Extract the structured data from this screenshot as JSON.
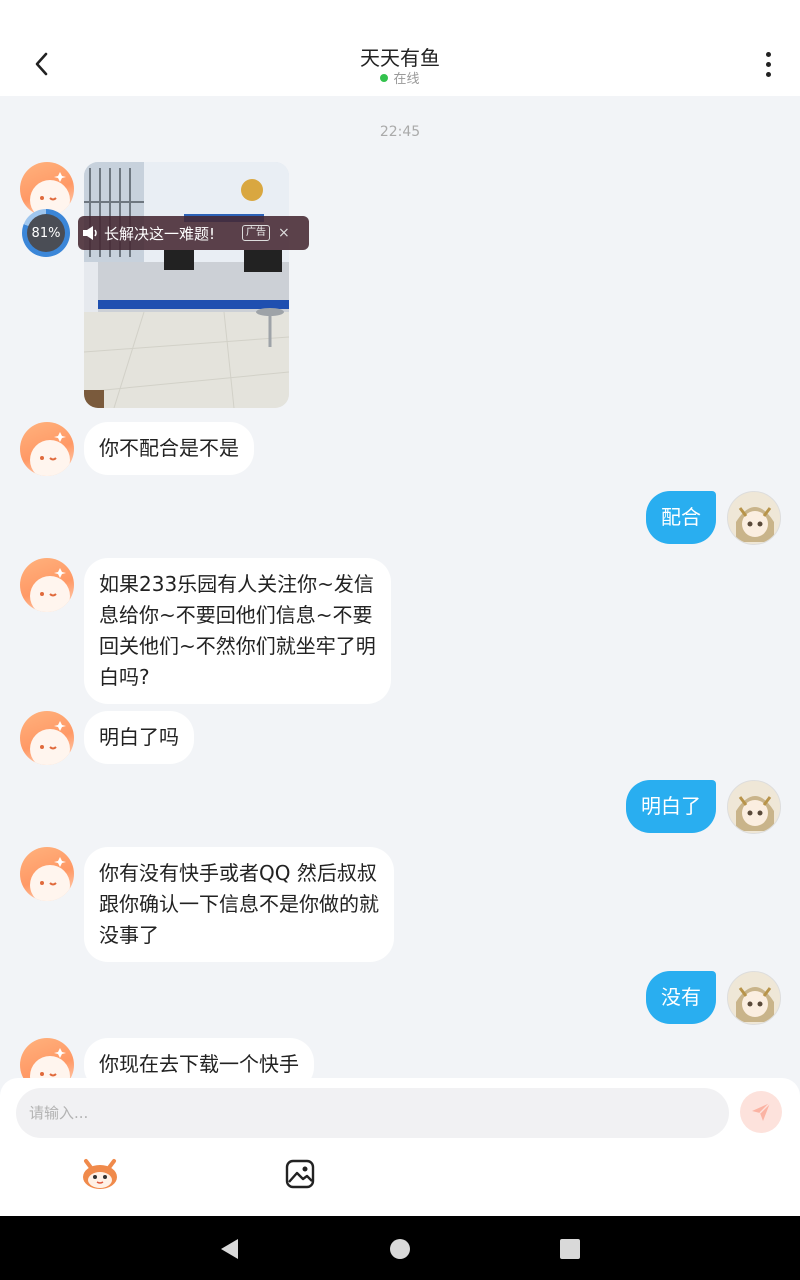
{
  "header": {
    "title": "天天有鱼",
    "status": "在线"
  },
  "chat": {
    "timestamp": "22:45",
    "progress_label": "81%",
    "ad": {
      "text": "长解决这一难题!",
      "tag": "广告",
      "close": "×"
    },
    "messages": [
      {
        "side": "left",
        "type": "image"
      },
      {
        "side": "left",
        "text": "你不配合是不是"
      },
      {
        "side": "right",
        "text": "配合"
      },
      {
        "side": "left",
        "lines": [
          "如果233乐园有人关注你~发信",
          "息给你~不要回他们信息~不要",
          "回关他们~不然你们就坐牢了明",
          "白吗?"
        ]
      },
      {
        "side": "left",
        "text": "明白了吗"
      },
      {
        "side": "right",
        "text": "明白了"
      },
      {
        "side": "left",
        "lines": [
          "你有没有快手或者QQ 然后叔叔",
          "跟你确认一下信息不是你做的就",
          "没事了"
        ]
      },
      {
        "side": "right",
        "text": "没有"
      },
      {
        "side": "left",
        "text": "你现在去下载一个快手"
      }
    ]
  },
  "input": {
    "placeholder": "请输入..."
  },
  "icons": {
    "back": "back-arrow-icon",
    "more": "more-vertical-icon",
    "send": "send-icon",
    "emoji": "mascot-emoji-icon",
    "image": "image-icon",
    "nav_back": "nav-back-icon",
    "nav_home": "nav-home-icon",
    "nav_recent": "nav-recent-icon"
  },
  "colors": {
    "accent": "#29aef0",
    "online": "#33c24d",
    "bot_avatar": "#ff9966",
    "send_bg": "#fde2dc"
  }
}
